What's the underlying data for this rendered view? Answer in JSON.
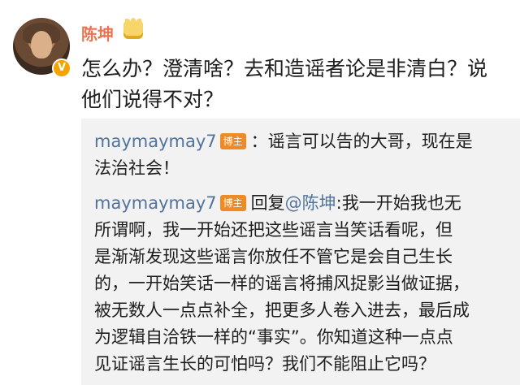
{
  "post": {
    "author": "陈坤",
    "text_line1": "怎么办？澄清啥？去和造谣者论是非清白？说",
    "text_line2": "他们说得不对？"
  },
  "icons": {
    "verified": "verified-badge-icon",
    "crown": "crown-icon"
  },
  "colors": {
    "author_name": "#eb7350",
    "quote_name": "#51749c",
    "tag_bg": "#f08a24",
    "quote_bg": "#f2f2f2"
  },
  "quoted": {
    "comment1": {
      "name": "maymaymay7",
      "tag": "博主",
      "text_a": "：谣言可以告的大哥，现在是",
      "text_b": "法治社会！"
    },
    "comment2": {
      "name": "maymaymay7",
      "tag": "博主",
      "reply_prefix": "回复",
      "mention": "@陈坤",
      "text_a": ":我一开始我也无",
      "lines": [
        "所谓啊，我一开始还把这些谣言当笑话看呢，但",
        "是渐渐发现这些谣言你放任不管它是会自己生长",
        "的，一开始笑话一样的谣言将捕风捉影当做证据，",
        "被无数人一点点补全，把更多人卷入进去，最后成",
        "为逻辑自洽铁一样的“事实”。你知道这种一点点",
        "见证谣言生长的可怕吗？我们不能阻止它吗？"
      ]
    }
  }
}
